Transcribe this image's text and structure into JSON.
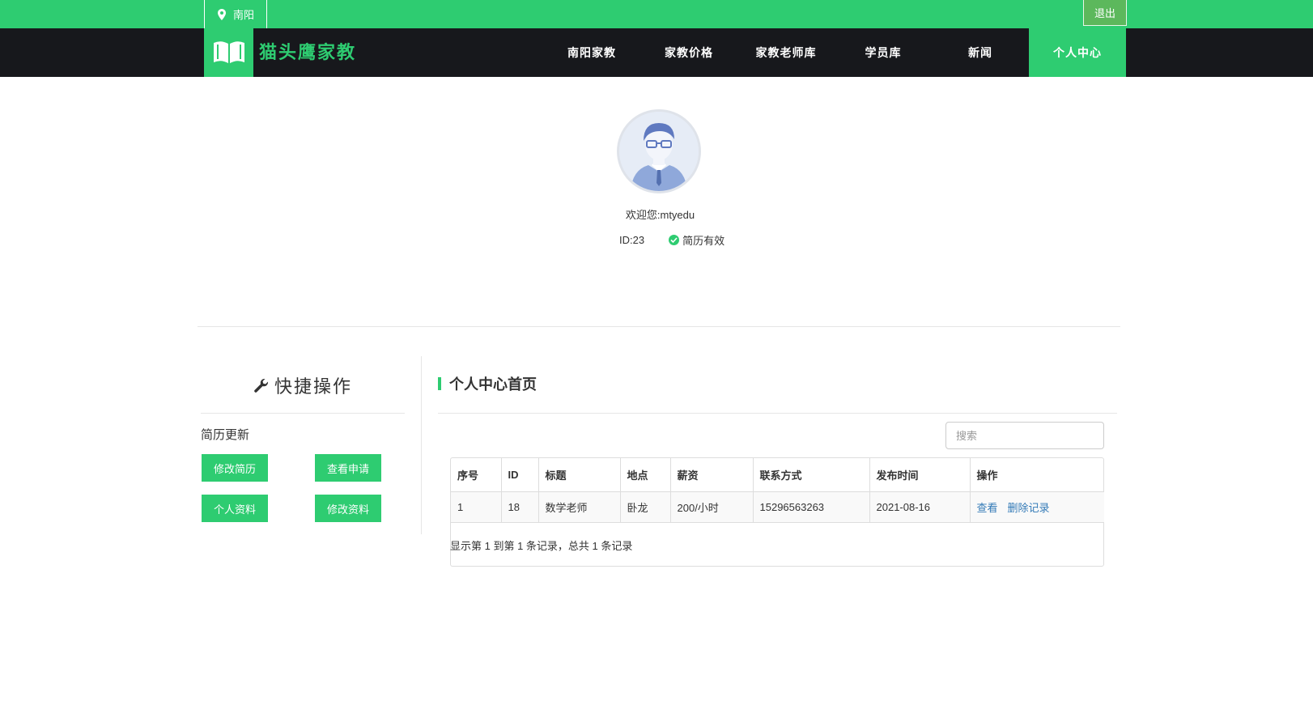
{
  "topbar": {
    "city": "南阳",
    "logout": "退出"
  },
  "brand": {
    "name": "猫头鹰家教"
  },
  "nav": [
    {
      "label": "南阳家教"
    },
    {
      "label": "家教价格"
    },
    {
      "label": "家教老师库"
    },
    {
      "label": "学员库"
    },
    {
      "label": "新闻"
    },
    {
      "label": "个人中心",
      "active": true
    }
  ],
  "profile": {
    "welcome_label": "欢迎您:",
    "username": "mtyedu",
    "id_text": "ID:23",
    "status": "简历有效"
  },
  "sidebar": {
    "title": "快捷操作",
    "section": "简历更新",
    "buttons": [
      "修改简历",
      "查看申请",
      "个人资料",
      "修改资料"
    ]
  },
  "main": {
    "title": "个人中心首页",
    "search_placeholder": "搜索",
    "table": {
      "headers": [
        "序号",
        "ID",
        "标题",
        "地点",
        "薪资",
        "联系方式",
        "发布时间",
        "操作"
      ],
      "rows": [
        {
          "no": "1",
          "id": "18",
          "title": "数学老师",
          "location": "卧龙",
          "salary": "200/小时",
          "contact": "15296563263",
          "date": "2021-08-16",
          "view": "查看",
          "delete": "删除记录"
        }
      ]
    },
    "pager": "显示第 1 到第 1 条记录，总共 1 条记录"
  },
  "colors": {
    "accent": "#2ecc71",
    "nav_bg": "#17181c",
    "link": "#337ab7"
  }
}
